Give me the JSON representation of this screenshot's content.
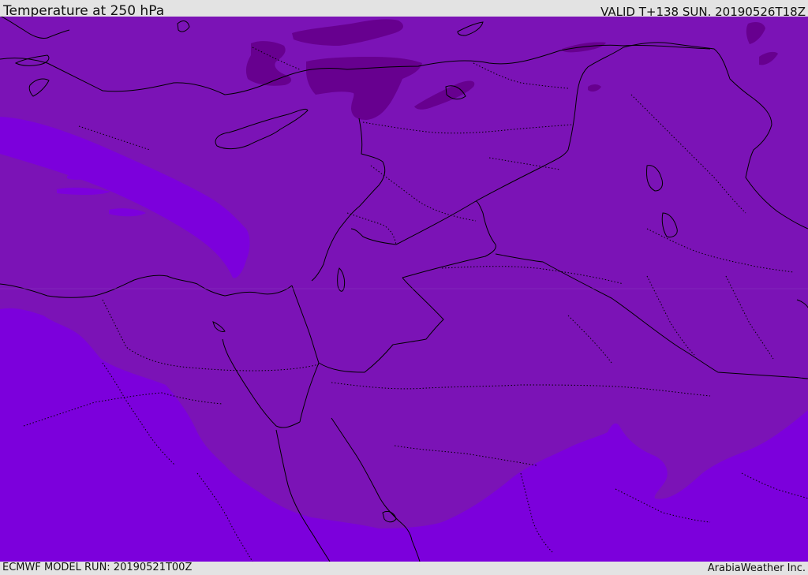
{
  "header": {
    "title": "Temperature at 250 hPa",
    "valid_time": "VALID T+138 SUN. 20190526T18Z"
  },
  "footer": {
    "model_run": "ECMWF MODEL RUN: 20190521T00Z",
    "credit": "ArabiaWeather Inc."
  },
  "colors": {
    "base_field": "#7b13b6",
    "warm_field": "#7c00dc",
    "cold_field": "#67008f",
    "border_line": "#000000",
    "bar_background": "#e3e3e3"
  }
}
